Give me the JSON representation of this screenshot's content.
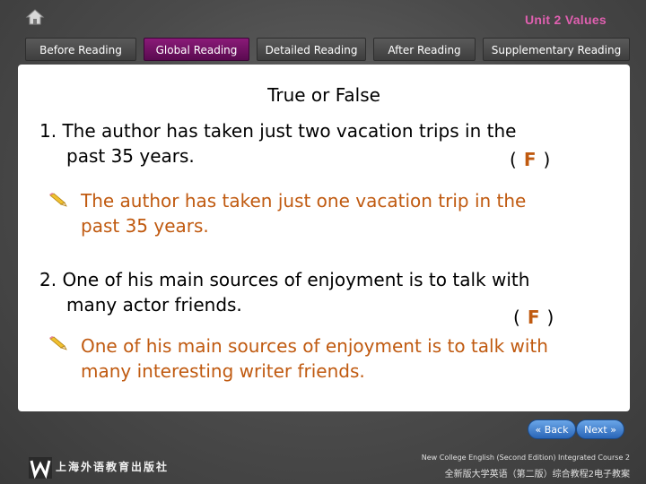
{
  "header": {
    "unit_title": "Unit 2 Values"
  },
  "nav": {
    "tabs": [
      {
        "label": "Before Reading",
        "active": false
      },
      {
        "label": "Global Reading",
        "active": true
      },
      {
        "label": "Detailed Reading",
        "active": false
      },
      {
        "label": "After Reading",
        "active": false
      },
      {
        "label": "Supplementary Reading",
        "active": false
      }
    ]
  },
  "content": {
    "heading": "True or False",
    "items": [
      {
        "line1": "1. The author has taken just two vacation trips in the",
        "line2": "past 35 years.",
        "answer_open": "(",
        "answer": "F",
        "answer_close": ")",
        "correction1": "The author has taken just one vacation trip in the",
        "correction2": "past 35 years."
      },
      {
        "line1": "2. One of his main sources of enjoyment is to talk with",
        "line2": "many actor friends.",
        "answer_open": "(",
        "answer": "F",
        "answer_close": ")",
        "correction1": "One of his main sources of enjoyment is to talk with",
        "correction2": "many interesting writer friends."
      }
    ]
  },
  "footer": {
    "back_label": "Back",
    "next_label": "Next",
    "publisher": "上海外语教育出版社",
    "book_en": "New College English (Second Edition) Integrated Course 2",
    "book_cn": "全新版大学英语（第二版）综合教程2电子教案"
  },
  "colors": {
    "accent": "#c05a10",
    "active_tab": "#7a1468",
    "title": "#e060b0"
  },
  "icons": [
    "home-icon",
    "pencil-icon",
    "back-arrow-icon",
    "next-arrow-icon",
    "logo-w-icon"
  ]
}
